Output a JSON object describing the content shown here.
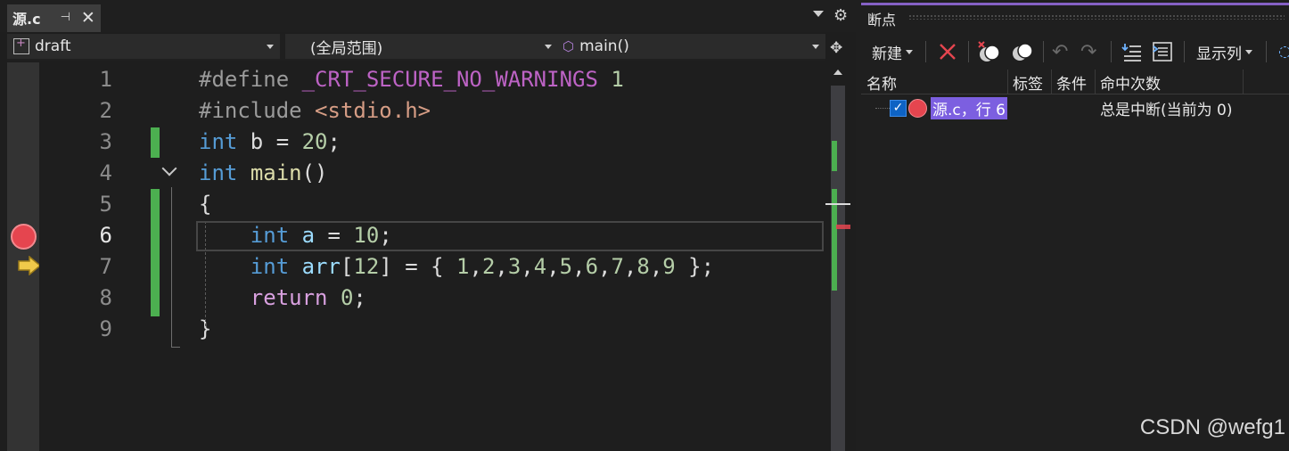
{
  "editor": {
    "tab": {
      "title": "源.c",
      "pin_glyph": "⊣",
      "close_glyph": "✕"
    },
    "toolbar_icons": [
      "chevron-down-icon",
      "gear-icon",
      "split-window-icon"
    ],
    "navbar": {
      "project": "draft",
      "scope": "(全局范围)",
      "member": "main()"
    },
    "current_line": 6,
    "lines": [
      {
        "n": "1",
        "tokens": [
          [
            "pp",
            "#define "
          ],
          [
            "mac",
            "_CRT_SECURE_NO_WARNINGS"
          ],
          [
            "plain",
            " "
          ],
          [
            "num",
            "1"
          ]
        ]
      },
      {
        "n": "2",
        "tokens": [
          [
            "pp",
            "#include "
          ],
          [
            "str",
            "<stdio.h>"
          ]
        ]
      },
      {
        "n": "3",
        "tokens": [
          [
            "kw",
            "int"
          ],
          [
            "plain",
            " b = "
          ],
          [
            "num",
            "20"
          ],
          [
            "plain",
            ";"
          ]
        ]
      },
      {
        "n": "4",
        "tokens": [
          [
            "kw",
            "int"
          ],
          [
            "plain",
            " "
          ],
          [
            "fn",
            "main"
          ],
          [
            "plain",
            "()"
          ]
        ]
      },
      {
        "n": "5",
        "tokens": [
          [
            "plain",
            "{"
          ]
        ]
      },
      {
        "n": "6",
        "tokens": [
          [
            "plain",
            "    "
          ],
          [
            "kw",
            "int"
          ],
          [
            "plain",
            " "
          ],
          [
            "var",
            "a"
          ],
          [
            "plain",
            " = "
          ],
          [
            "num",
            "10"
          ],
          [
            "plain",
            ";"
          ]
        ]
      },
      {
        "n": "7",
        "tokens": [
          [
            "plain",
            "    "
          ],
          [
            "kw",
            "int"
          ],
          [
            "plain",
            " "
          ],
          [
            "var",
            "arr"
          ],
          [
            "plain",
            "["
          ],
          [
            "num",
            "12"
          ],
          [
            "plain",
            "] = { "
          ],
          [
            "num",
            "1"
          ],
          [
            "plain",
            ","
          ],
          [
            "num",
            "2"
          ],
          [
            "plain",
            ","
          ],
          [
            "num",
            "3"
          ],
          [
            "plain",
            ","
          ],
          [
            "num",
            "4"
          ],
          [
            "plain",
            ","
          ],
          [
            "num",
            "5"
          ],
          [
            "plain",
            ","
          ],
          [
            "num",
            "6"
          ],
          [
            "plain",
            ","
          ],
          [
            "num",
            "7"
          ],
          [
            "plain",
            ","
          ],
          [
            "num",
            "8"
          ],
          [
            "plain",
            ","
          ],
          [
            "num",
            "9"
          ],
          [
            "plain",
            " };"
          ]
        ]
      },
      {
        "n": "8",
        "tokens": [
          [
            "plain",
            "    "
          ],
          [
            "ret",
            "return"
          ],
          [
            "plain",
            " "
          ],
          [
            "num",
            "0"
          ],
          [
            "plain",
            ";"
          ]
        ]
      },
      {
        "n": "9",
        "tokens": [
          [
            "plain",
            "}"
          ]
        ]
      }
    ]
  },
  "breakpoints": {
    "title": "断点",
    "toolbar": {
      "new_label": "新建",
      "columns_label": "显示列",
      "icons": [
        "delete-icon",
        "disable-all-icon",
        "enable-all-icon",
        "undo-icon",
        "redo-icon",
        "export-icon",
        "import-icon"
      ]
    },
    "columns": [
      "名称",
      "标签",
      "条件",
      "命中次数"
    ],
    "rows": [
      {
        "checked": true,
        "name": "源.c，行 6",
        "hit_count": "总是中断(当前为 0)"
      }
    ]
  },
  "watermark": "CSDN @wefg1",
  "colors": {
    "accent": "#8561c5",
    "breakpoint": "#e5454f",
    "selection": "#7c5fe0",
    "change_bar": "#4caf50"
  }
}
